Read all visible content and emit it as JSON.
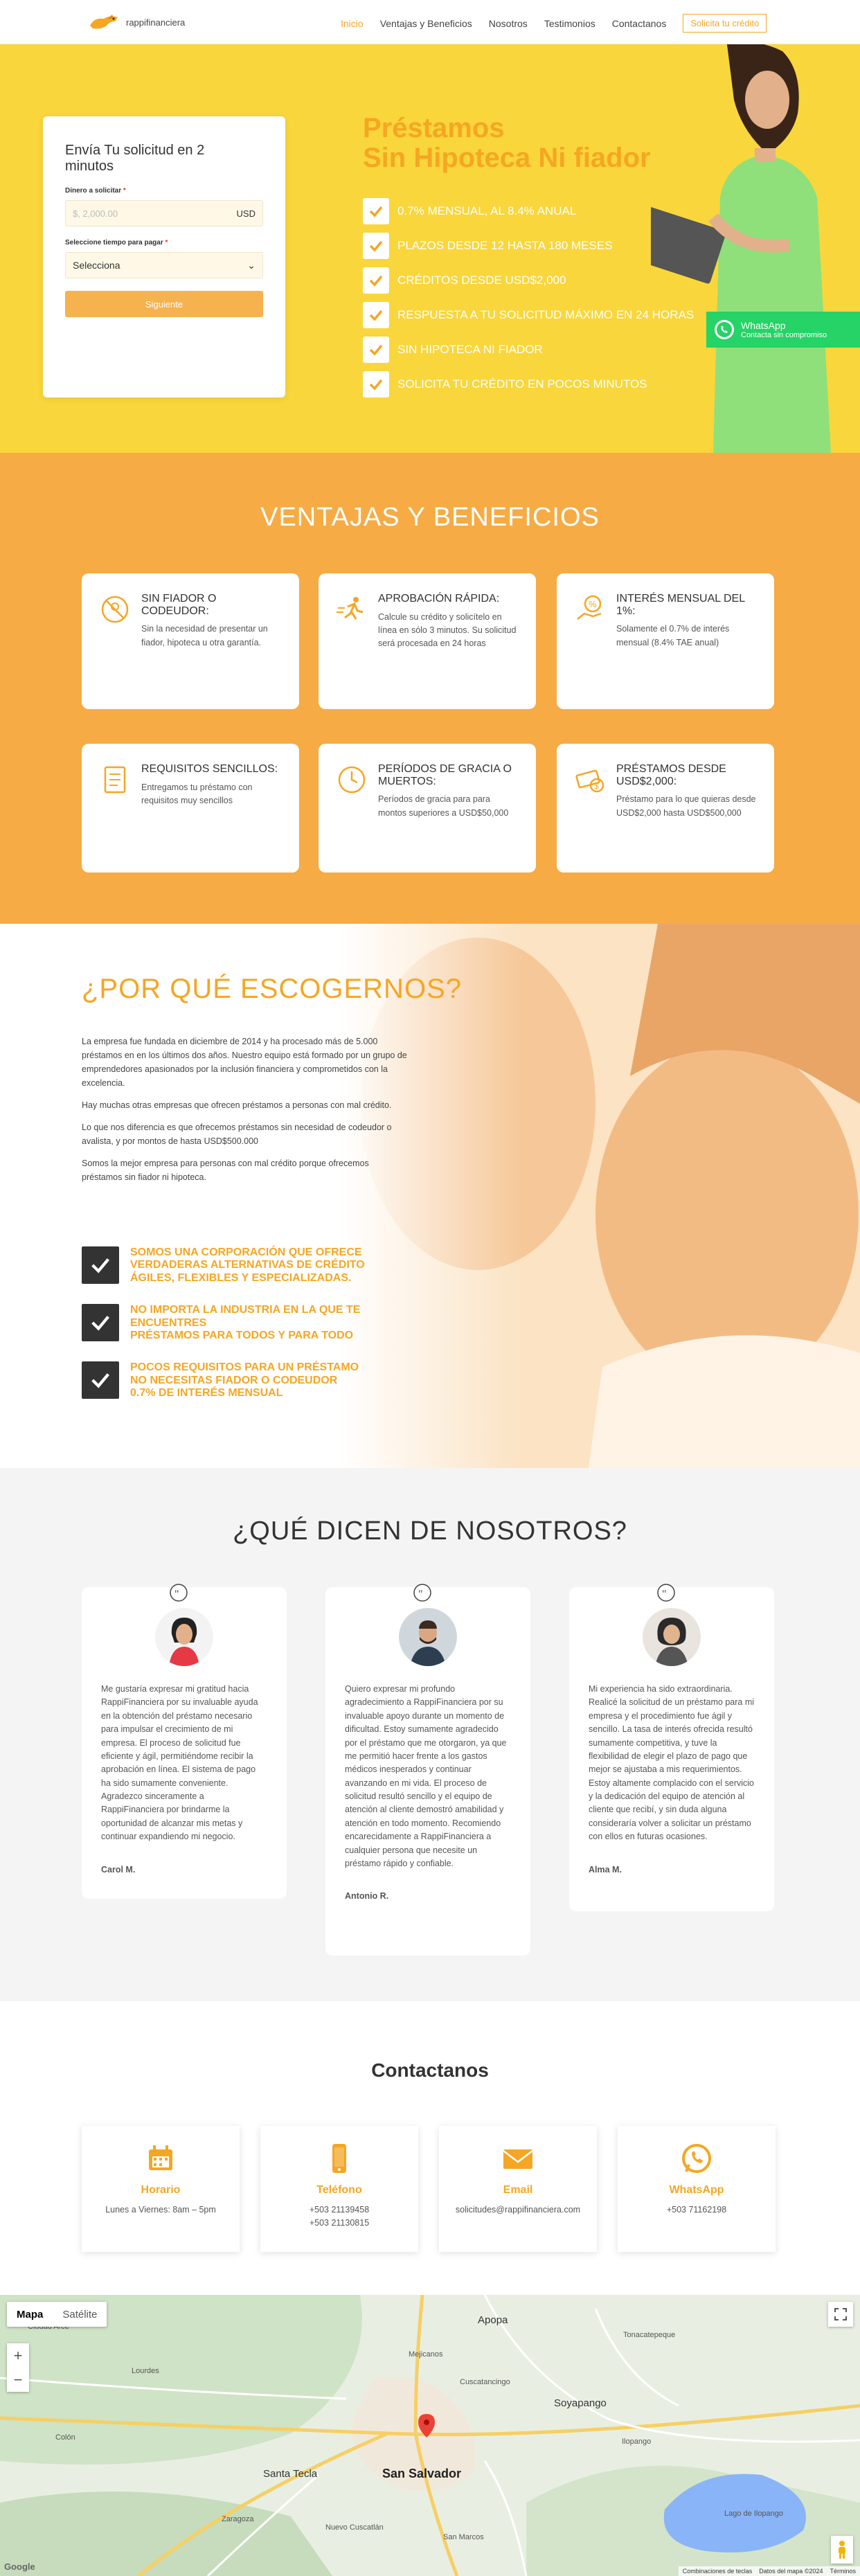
{
  "header": {
    "logo_text": "rappifinanciera",
    "nav": [
      "Inicio",
      "Ventajas y Beneficios",
      "Nosotros",
      "Testimonios",
      "Contactanos"
    ],
    "cta": "Solicita tu crédito"
  },
  "hero": {
    "form": {
      "title": "Envía Tu solicitud en 2 minutos",
      "amount_label": "Dinero a solicitar",
      "amount_placeholder": "$, 2,000.00",
      "currency": "USD",
      "term_label": "Seleccione tiempo para pagar",
      "term_value": "Selecciona",
      "submit": "Siguiente"
    },
    "title_line1": "Préstamos",
    "title_line2": "Sin Hipoteca Ni fiador",
    "features": [
      "0.7% MENSUAL, AL 8.4% ANUAL",
      "PLAZOS DESDE 12 HASTA 180 MESES",
      "CRÉDITOS DESDE USD$2,000",
      "RESPUESTA A TU SOLICITUD MÁXIMO EN 24 HORAS",
      "SIN HIPOTECA NI FIADOR",
      "SOLICITA TU CRÉDITO EN POCOS MINUTOS"
    ],
    "whatsapp": {
      "title": "WhatsApp",
      "subtitle": "Contacta sin compromiso"
    }
  },
  "benefits": {
    "heading": "VENTAJAS Y BENEFICIOS",
    "items": [
      {
        "title": "SIN FIADOR O CODEUDOR:",
        "text": "Sin la necesidad de presentar un fiador, hipoteca u otra garantía.",
        "icon": "no-guarantor-icon"
      },
      {
        "title": "APROBACIÓN RÁPIDA:",
        "text": "Calcule su crédito y solicítelo en línea en sólo 3 minutos. Su solicitud será procesada en 24 horas",
        "icon": "running-icon"
      },
      {
        "title": "INTERÉS MENSUAL DEL 1%:",
        "text": "Solamente el 0.7% de interés mensual (8.4% TAE anual)",
        "icon": "percent-hand-icon"
      },
      {
        "title": "REQUISITOS SENCILLOS:",
        "text": "Entregamos tu préstamo con requisitos muy sencillos",
        "icon": "checklist-icon"
      },
      {
        "title": "PERÍODOS DE GRACIA O MUERTOS:",
        "text": "Períodos de gracia para para montos superiores a USD$50,000",
        "icon": "clock-icon"
      },
      {
        "title": "PRÉSTAMOS DESDE USD$2,000:",
        "text": "Préstamo para lo que quieras desde USD$2,000 hasta USD$500,000",
        "icon": "money-icon"
      }
    ]
  },
  "why": {
    "heading": "¿POR QUÉ ESCOGERNOS?",
    "paragraphs": [
      "La empresa fue fundada en diciembre de 2014 y ha procesado más de 5.000 préstamos en en los últimos dos años. Nuestro equipo está formado por un grupo de emprendedores apasionados por la inclusión financiera y comprometidos con la excelencia.",
      "Hay muchas otras empresas que ofrecen préstamos a personas con mal crédito.",
      "Lo que nos diferencia es que ofrecemos préstamos sin necesidad de codeudor o avalista, y por montos de hasta USD$500.000",
      "Somos la mejor empresa para personas con mal crédito porque ofrecemos préstamos sin fiador ni hipoteca."
    ],
    "items": [
      "SOMOS UNA CORPORACIÓN QUE OFRECE\nVERDADERAS ALTERNATIVAS DE CRÉDITO\nÁGILES, FLEXIBLES Y ESPECIALIZADAS.",
      "NO IMPORTA LA INDUSTRIA EN LA QUE TE\nENCUENTRES\nPRÉSTAMOS PARA TODOS Y PARA TODO",
      "POCOS REQUISITOS PARA UN PRÉSTAMO\nNO NECESITAS FIADOR O CODEUDOR\n0.7% DE INTERÉS MENSUAL"
    ]
  },
  "testimonials": {
    "heading": "¿QUÉ DICEN DE NOSOTROS?",
    "items": [
      {
        "text": "Me gustaría expresar mi gratitud hacia RappiFinanciera por su invaluable ayuda en la obtención del préstamo necesario para impulsar el crecimiento de mi empresa. El proceso de solicitud fue eficiente y ágil, permitiéndome recibir la aprobación en línea. El sistema de pago ha sido sumamente conveniente. Agradezco sinceramente a RappiFinanciera por brindarme la oportunidad de alcanzar mis metas y continuar expandiendo mi negocio.",
        "author": "Carol M."
      },
      {
        "text": "Quiero expresar mi profundo agradecimiento a RappiFinanciera por su invaluable apoyo durante un momento de dificultad. Estoy sumamente agradecido por el préstamo que me otorgaron, ya que me permitió hacer frente a los gastos médicos inesperados y continuar avanzando en mi vida. El proceso de solicitud resultó sencillo y el equipo de atención al cliente demostró amabilidad y atención en todo momento. Recomiendo encarecidamente a RappiFinanciera a cualquier persona que necesite un préstamo rápido y confiable.",
        "author": "Antonio R."
      },
      {
        "text": "Mi experiencia ha sido extraordinaria. Realicé la solicitud de un préstamo para mi empresa y el procedimiento fue ágil y sencillo. La tasa de interés ofrecida resultó sumamente competitiva, y tuve la flexibilidad de elegir el plazo de pago que mejor se ajustaba a mis requerimientos. Estoy altamente complacido con el servicio y la dedicación del equipo de atención al cliente que recibí, y sin duda alguna consideraría volver a solicitar un préstamo con ellos en futuras ocasiones.",
        "author": "Alma M."
      }
    ]
  },
  "contact": {
    "heading": "Contactanos",
    "cards": [
      {
        "label": "Horario",
        "lines": [
          "Lunes a Viernes: 8am – 5pm"
        ],
        "icon": "calendar-icon"
      },
      {
        "label": "Teléfono",
        "lines": [
          "+503 21139458",
          "+503 21130815"
        ],
        "icon": "phone-icon"
      },
      {
        "label": "Email",
        "lines": [
          "solicitudes@rappifinanciera.com"
        ],
        "icon": "email-icon"
      },
      {
        "label": "WhatsApp",
        "lines": [
          "+503 71162198"
        ],
        "icon": "whatsapp-icon"
      }
    ]
  },
  "map": {
    "toggle": [
      "Mapa",
      "Satélite"
    ],
    "city": "San Salvador",
    "places": [
      "Santa Tecla",
      "Lourdes",
      "Ciudad Arce",
      "Soyapango",
      "Apopa",
      "Ilopango",
      "Nuevo Cuscatlán",
      "Lago de Ilopango",
      "Mejicanos",
      "Colón",
      "Zaragoza",
      "San Marcos",
      "Cuscatancingo",
      "Tonacatepeque"
    ],
    "footer": [
      "Combinaciones de teclas",
      "Datos del mapa ©2024",
      "Términos"
    ],
    "brand": "Google"
  },
  "colors": {
    "accent": "#f5a623",
    "hero_bg": "#f9d63b",
    "benefits_bg": "#f6ab44",
    "whatsapp": "#25d366"
  }
}
